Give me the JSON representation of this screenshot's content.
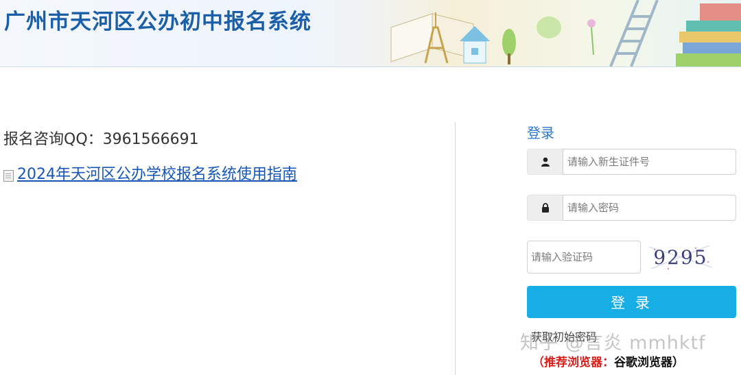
{
  "header": {
    "title": "广州市天河区公办初中报名系统"
  },
  "info": {
    "qq_line": "报名咨询QQ：3961566691",
    "guide_link": "2024年天河区公办学校报名系统使用指南"
  },
  "login": {
    "heading": "登录",
    "id_placeholder": "请输入新生证件号",
    "password_placeholder": "请输入密码",
    "captcha_placeholder": "请输入验证码",
    "captcha_code": "9295",
    "button_label": "登 录",
    "get_password_link": "获取初始密码",
    "browser_tip_prefix": "（推荐浏览器：",
    "browser_tip_name": "谷歌浏览器）"
  },
  "watermark": "知乎 @言炎 mmhktf",
  "colors": {
    "title_blue": "#1b5fa8",
    "link_blue": "#1556b8",
    "button_blue": "#17aee6",
    "tip_red": "#d9201c"
  },
  "icons": [
    "user-icon",
    "lock-icon",
    "document-icon"
  ]
}
